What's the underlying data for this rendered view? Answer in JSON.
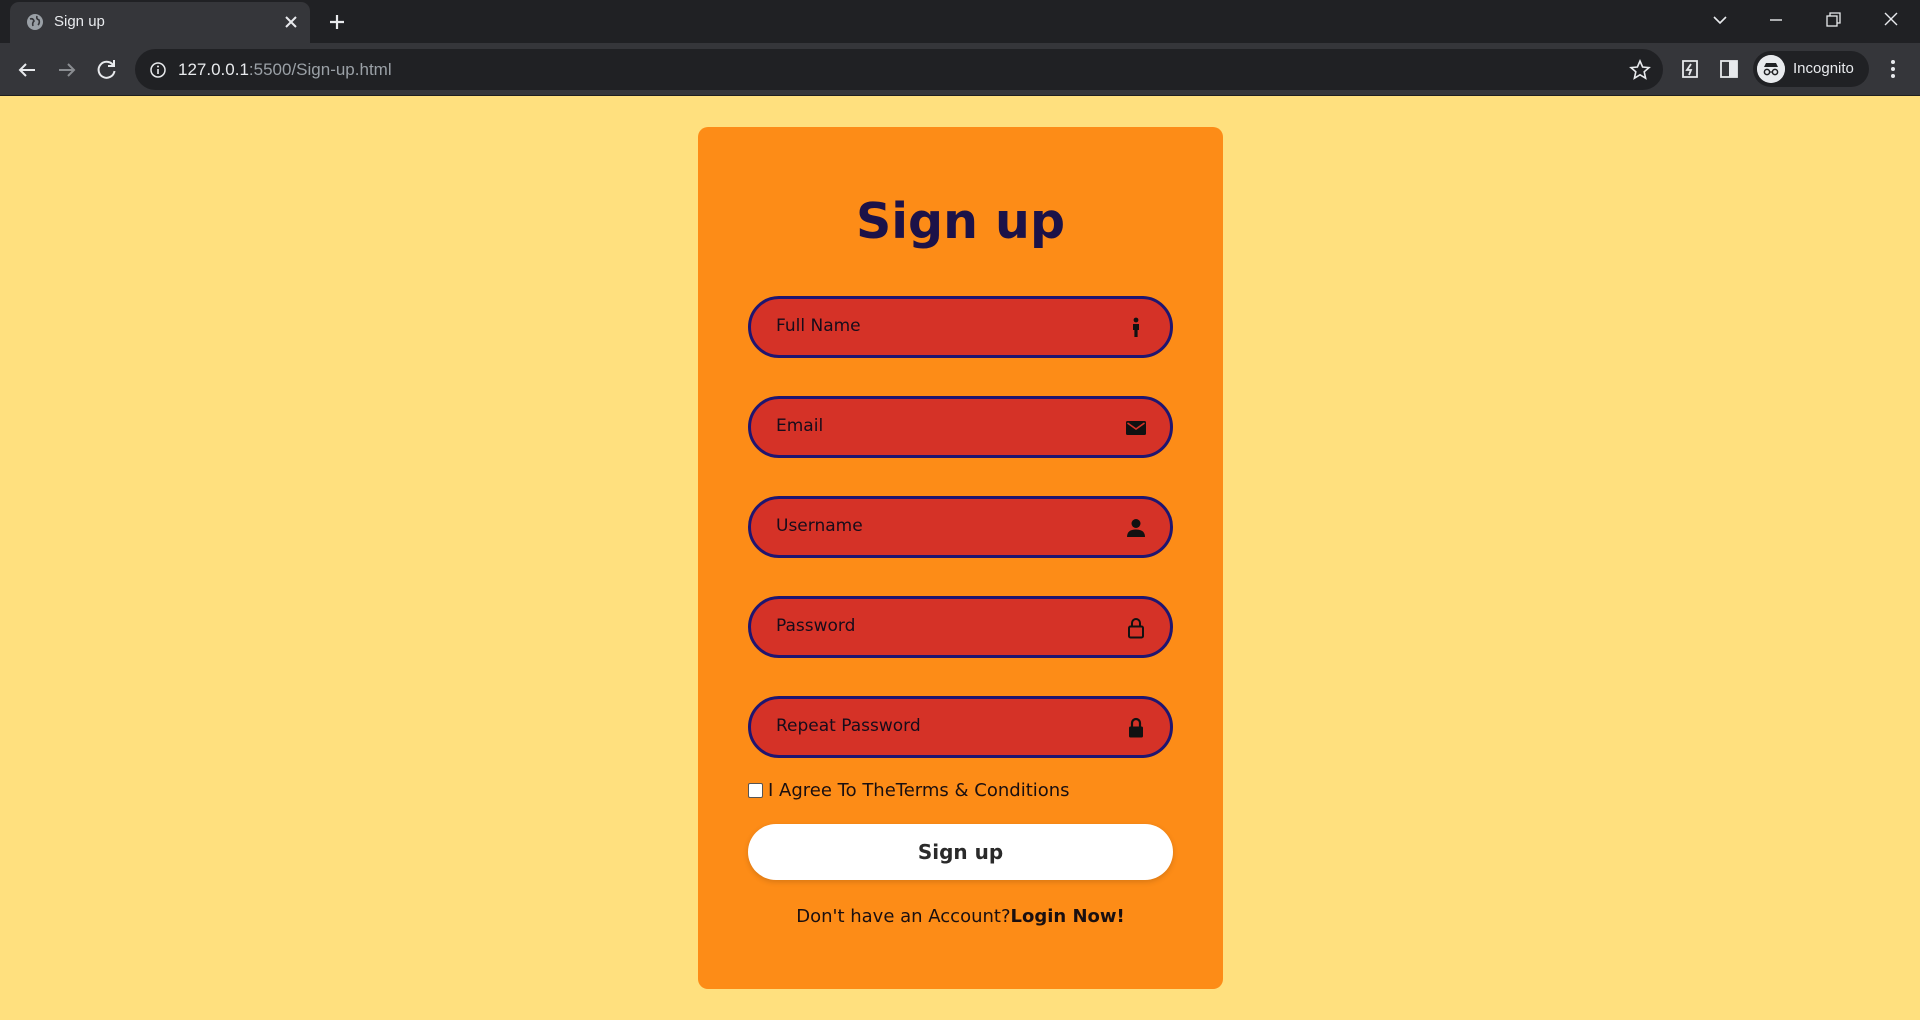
{
  "browser": {
    "tab_title": "Sign up",
    "url_host": "127.0.0.1",
    "url_path": ":5500/Sign-up.html",
    "profile_label": "Incognito"
  },
  "form": {
    "heading": "Sign up",
    "fields": [
      {
        "placeholder": "Full Name",
        "icon": "person-standing-icon"
      },
      {
        "placeholder": "Email",
        "icon": "envelope-icon"
      },
      {
        "placeholder": "Username",
        "icon": "user-icon"
      },
      {
        "placeholder": "Password",
        "icon": "lock-open-icon"
      },
      {
        "placeholder": "Repeat Password",
        "icon": "lock-closed-icon"
      }
    ],
    "agree_text": "I Agree To TheTerms & Conditions",
    "submit_label": "Sign up",
    "footer_text": "Don't have an Account?",
    "footer_link": "Login Now!"
  },
  "colors": {
    "page_background": "#ffe07e",
    "card_background": "#fd8c17",
    "field_background": "#d53227",
    "field_border": "#1f1570",
    "heading_color": "#1c1248"
  }
}
